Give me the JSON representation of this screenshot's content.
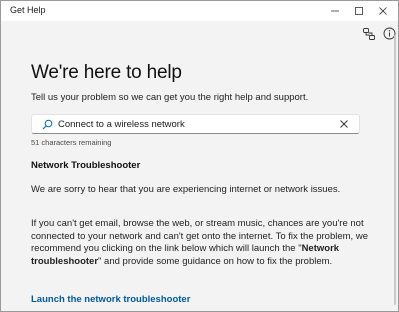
{
  "window": {
    "title": "Get Help",
    "controls": {
      "minimize": "minimize-icon",
      "maximize": "maximize-icon",
      "close": "close-icon"
    }
  },
  "toolbar": {
    "share_icon": "share-connection-icon",
    "info_icon": "info-icon"
  },
  "header": {
    "headline": "We're here to help",
    "subtitle": "Tell us your problem so we can get you the right help and support."
  },
  "search": {
    "value": "Connect to a wireless network",
    "placeholder": "",
    "char_count": "51 characters remaining"
  },
  "result": {
    "title": "Network Troubleshooter",
    "intro": "We are sorry to hear that you are experiencing internet or network issues.",
    "body_before": "If you can't get email, browse the web, or stream music, chances are you're not connected to your network and can't get onto the internet. To fix the problem, we recommend you clicking on the link below which will launch the \"",
    "body_bold": "Network troubleshooter",
    "body_after": "\" and provide some guidance on how to fix the problem.",
    "link_label": "Launch the network troubleshooter"
  },
  "colors": {
    "accent": "#005a9e",
    "background": "#f3f3f3"
  }
}
